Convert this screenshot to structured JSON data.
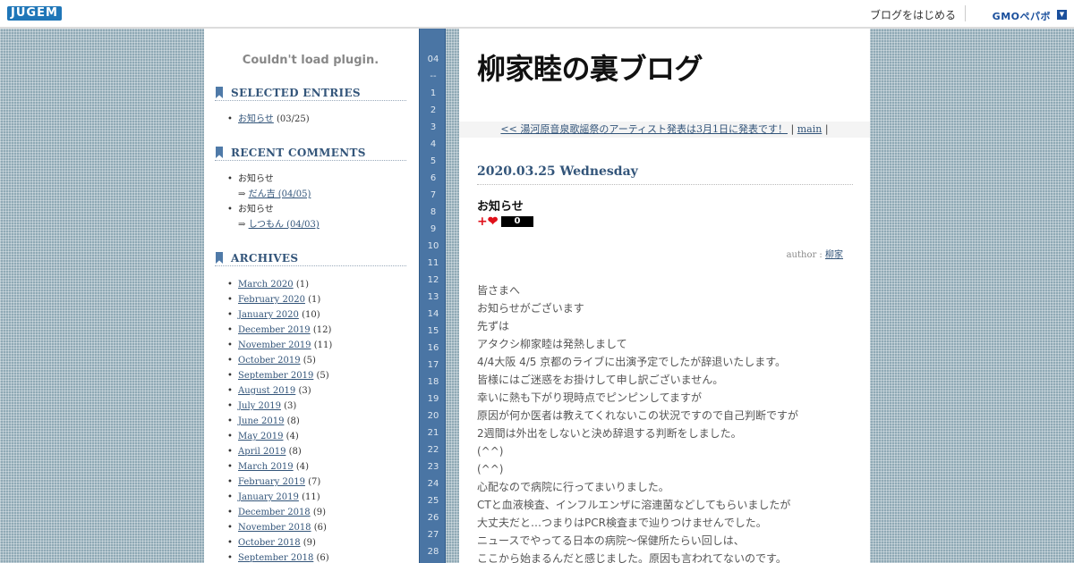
{
  "topbar": {
    "logo": "JUGEM",
    "start_blog": "ブログをはじめる",
    "gmo_logo": "GMOペパボ",
    "dropdown": "▼"
  },
  "sidebar": {
    "plugin_message": "Couldn't load plugin.",
    "selected_entries": {
      "heading": "SELECTED ENTRIES",
      "items": [
        {
          "title": "お知らせ",
          "date": "(03/25)"
        }
      ]
    },
    "recent_comments": {
      "heading": "RECENT COMMENTS",
      "items": [
        {
          "entry": "お知らせ",
          "arrow": "⇒",
          "author": "だん吉 (04/05)"
        },
        {
          "entry": "お知らせ",
          "arrow": "⇒",
          "author": "しつもん (04/03)"
        }
      ]
    },
    "archives": {
      "heading": "ARCHIVES",
      "items": [
        {
          "month": "March 2020",
          "count": "(1)"
        },
        {
          "month": "February 2020",
          "count": "(1)"
        },
        {
          "month": "January 2020",
          "count": "(10)"
        },
        {
          "month": "December 2019",
          "count": "(12)"
        },
        {
          "month": "November 2019",
          "count": "(11)"
        },
        {
          "month": "October 2019",
          "count": "(5)"
        },
        {
          "month": "September 2019",
          "count": "(5)"
        },
        {
          "month": "August 2019",
          "count": "(3)"
        },
        {
          "month": "July 2019",
          "count": "(3)"
        },
        {
          "month": "June 2019",
          "count": "(8)"
        },
        {
          "month": "May 2019",
          "count": "(4)"
        },
        {
          "month": "April 2019",
          "count": "(8)"
        },
        {
          "month": "March 2019",
          "count": "(4)"
        },
        {
          "month": "February 2019",
          "count": "(7)"
        },
        {
          "month": "January 2019",
          "count": "(11)"
        },
        {
          "month": "December 2018",
          "count": "(9)"
        },
        {
          "month": "November 2018",
          "count": "(6)"
        },
        {
          "month": "October 2018",
          "count": "(9)"
        },
        {
          "month": "September 2018",
          "count": "(6)"
        }
      ]
    }
  },
  "calendar": {
    "labels": [
      "04",
      "--",
      "1",
      "2",
      "3",
      "4",
      "5",
      "6",
      "7",
      "8",
      "9",
      "10",
      "11",
      "12",
      "13",
      "14",
      "15",
      "16",
      "17",
      "18",
      "19",
      "20",
      "21",
      "22",
      "23",
      "24",
      "25",
      "26",
      "27",
      "28"
    ]
  },
  "main": {
    "blog_title": "柳家睦の裏ブログ",
    "nav": {
      "prev": "<< 湯河原音泉歌謡祭のアーティスト発表は3月1日に発表です！",
      "separator": "|",
      "main_link": "main",
      "separator2": "|"
    },
    "post": {
      "date": "2020.03.25 Wednesday",
      "title": "お知らせ",
      "like_icon": "+❤",
      "like_count": "0",
      "author_label": "author :",
      "author": "柳家",
      "body": [
        "皆さまへ",
        "お知らせがございます",
        "先ずは",
        "アタクシ柳家睦は発熱しまして",
        "4/4大阪 4/5 京都のライブに出演予定でしたが辞退いたします。",
        "皆様にはご迷惑をお掛けして申し訳ございません。",
        "幸いに熱も下がり現時点でピンピンしてますが",
        "原因が何か医者は教えてくれないこの状況ですので自己判断ですが",
        "2週間は外出をしないと決め辞退する判断をしました。",
        "(^^)",
        "(^^)",
        "心配なので病院に行ってまいりました。",
        "CTと血液検査、インフルエンザに溶連菌などしてもらいましたが",
        "大丈夫だと…つまりはPCR検査まで辿りつけませんでした。",
        "ニュースでやってる日本の病院〜保健所たらい回しは、",
        "ここから始まるんだと感じました。原因も言われてないのです。"
      ]
    }
  }
}
